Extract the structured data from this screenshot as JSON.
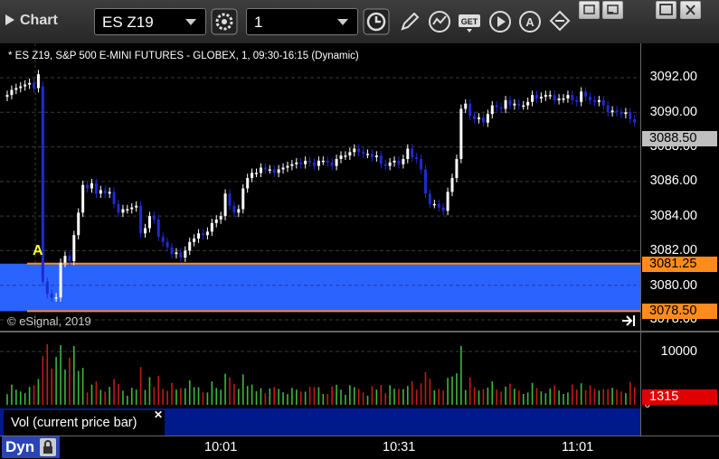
{
  "window": {
    "title": "Chart",
    "symbol": "ES Z19",
    "interval": "1",
    "icons": [
      "settings-icon",
      "clock-icon",
      "pencil-icon",
      "study-icon",
      "get-data-icon",
      "play-icon",
      "alert-icon",
      "link-icon"
    ],
    "window_buttons": [
      "restore-icon",
      "maximize-icon",
      "close-icon"
    ]
  },
  "chart": {
    "info": "* ES Z19, S&P 500 E-MINI FUTURES - GLOBEX, 1, 09:30-16:15 (Dynamic)",
    "copyright": "© eSignal, 2019",
    "zone_marker": "A",
    "zone_color": "#2a63ff",
    "zone_line_color": "#ff8c1a",
    "up_color": "#ffffff",
    "down_color": "#1e2bd0",
    "price_ticks": [
      "3092.00",
      "3090.00",
      "3088.00",
      "3086.00",
      "3084.00",
      "3082.00",
      "3080.00",
      "3078.00"
    ],
    "last_price": "3088.50",
    "zone_high": "3081.25",
    "zone_low": "3078.50",
    "vol_ticks": [
      "10000",
      "0"
    ],
    "vol_last": "1315",
    "vol_label": "Vol (current price bar)",
    "time_ticks": [
      "10:01",
      "10:31",
      "11:01"
    ],
    "mode_label": "Dyn"
  },
  "chart_data": {
    "type": "candlestick",
    "title": "ES Z19, S&P 500 E-MINI FUTURES - GLOBEX, 1, 09:30-16:15 (Dynamic)",
    "interval_minutes": 1,
    "ylim": [
      3077.5,
      3093.0
    ],
    "closes": [
      3091.0,
      3091.3,
      3091.4,
      3091.5,
      3091.6,
      3091.7,
      3091.4,
      3092.2,
      3080.2,
      3079.5,
      3079.3,
      3079.3,
      3081.3,
      3081.7,
      3081.4,
      3082.9,
      3084.2,
      3085.8,
      3085.6,
      3085.9,
      3085.3,
      3085.5,
      3085.3,
      3085.4,
      3084.7,
      3084.2,
      3084.4,
      3084.4,
      3084.5,
      3084.6,
      3083.0,
      3083.3,
      3084.0,
      3083.8,
      3082.8,
      3082.5,
      3082.2,
      3081.8,
      3081.9,
      3081.6,
      3082.0,
      3082.5,
      3082.7,
      3083.0,
      3082.9,
      3083.1,
      3083.6,
      3083.8,
      3084.0,
      3085.3,
      3084.6,
      3084.2,
      3084.4,
      3085.6,
      3086.2,
      3086.5,
      3086.5,
      3086.8,
      3086.7,
      3086.7,
      3086.5,
      3086.7,
      3086.8,
      3086.9,
      3087.0,
      3087.1,
      3087.0,
      3087.2,
      3087.1,
      3086.9,
      3087.2,
      3087.2,
      3087.1,
      3086.9,
      3087.3,
      3087.5,
      3087.5,
      3087.7,
      3087.9,
      3087.7,
      3087.6,
      3087.6,
      3087.4,
      3087.5,
      3087.0,
      3086.9,
      3087.1,
      3087.2,
      3087.0,
      3087.3,
      3087.9,
      3087.4,
      3087.3,
      3086.7,
      3085.3,
      3084.7,
      3084.7,
      3084.5,
      3084.3,
      3085.4,
      3086.2,
      3087.3,
      3090.2,
      3090.5,
      3089.8,
      3089.6,
      3089.7,
      3089.4,
      3089.9,
      3090.4,
      3090.3,
      3090.2,
      3090.7,
      3090.4,
      3090.5,
      3090.4,
      3090.4,
      3090.6,
      3091.0,
      3090.8,
      3090.9,
      3091.0,
      3091.0,
      3090.7,
      3090.8,
      3090.8,
      3091.0,
      3090.7,
      3090.6,
      3091.2,
      3090.9,
      3090.7,
      3090.6,
      3090.7,
      3090.4,
      3090.0,
      3090.1,
      3090.0,
      3089.9,
      3090.0,
      3089.6,
      3089.4
    ]
  },
  "pixel_map": {}
}
